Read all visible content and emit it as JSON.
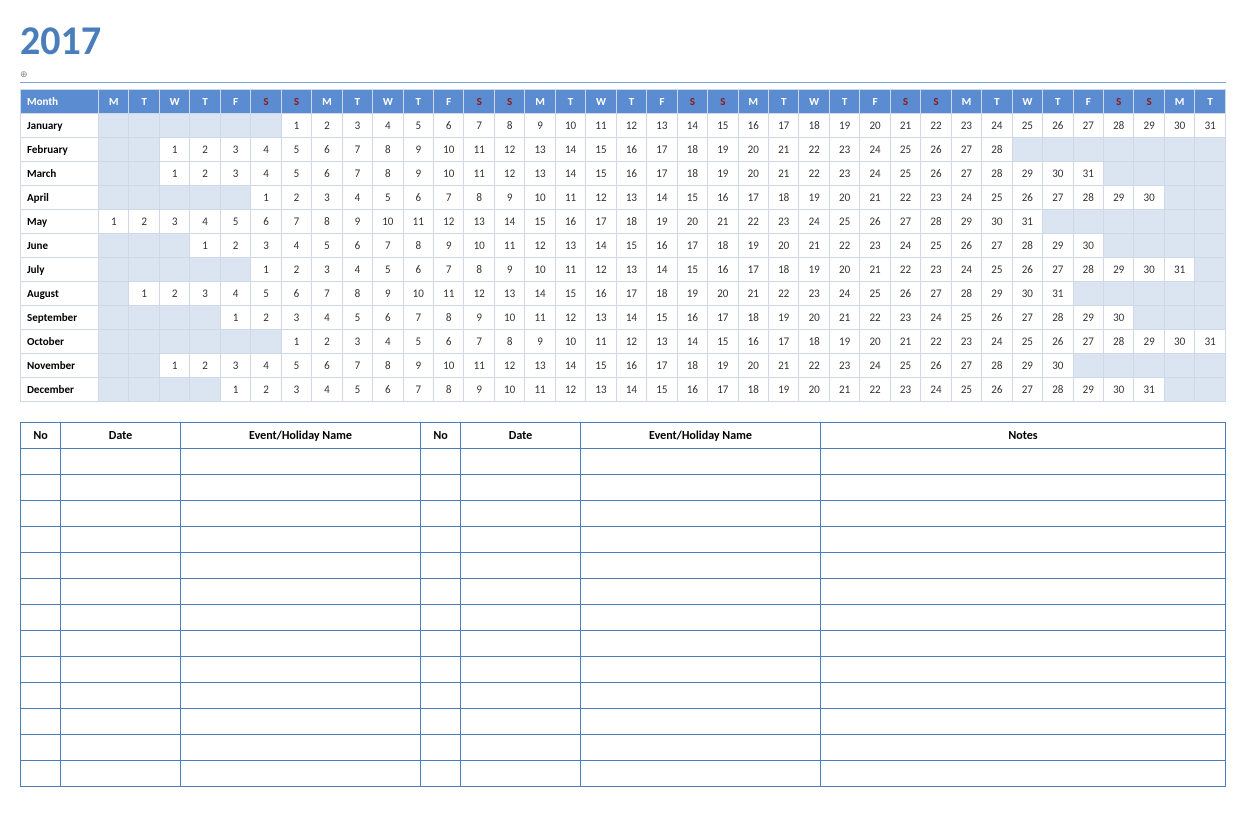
{
  "year": "2017",
  "header": {
    "month_label": "Month",
    "weekdays": [
      "M",
      "T",
      "W",
      "T",
      "F",
      "S",
      "S",
      "M",
      "T",
      "W",
      "T",
      "F",
      "S",
      "S",
      "M",
      "T",
      "W",
      "T",
      "F",
      "S",
      "S",
      "M",
      "T",
      "W",
      "T",
      "F",
      "S",
      "S",
      "M",
      "T",
      "W",
      "T",
      "F",
      "S",
      "S",
      "M",
      "T"
    ],
    "weekend_idx": [
      5,
      6,
      12,
      13,
      19,
      20,
      26,
      27,
      33,
      34
    ]
  },
  "months": [
    {
      "name": "January",
      "start": 6,
      "days": 31
    },
    {
      "name": "February",
      "start": 2,
      "days": 28
    },
    {
      "name": "March",
      "start": 2,
      "days": 31
    },
    {
      "name": "April",
      "start": 5,
      "days": 30
    },
    {
      "name": "May",
      "start": 0,
      "days": 31
    },
    {
      "name": "June",
      "start": 3,
      "days": 30
    },
    {
      "name": "July",
      "start": 5,
      "days": 31
    },
    {
      "name": "August",
      "start": 1,
      "days": 31
    },
    {
      "name": "September",
      "start": 4,
      "days": 30
    },
    {
      "name": "October",
      "start": 6,
      "days": 31
    },
    {
      "name": "November",
      "start": 2,
      "days": 30
    },
    {
      "name": "December",
      "start": 4,
      "days": 31
    }
  ],
  "events_table": {
    "headers": [
      "No",
      "Date",
      "Event/Holiday Name",
      "No",
      "Date",
      "Event/Holiday Name",
      "Notes"
    ],
    "row_count": 13
  }
}
